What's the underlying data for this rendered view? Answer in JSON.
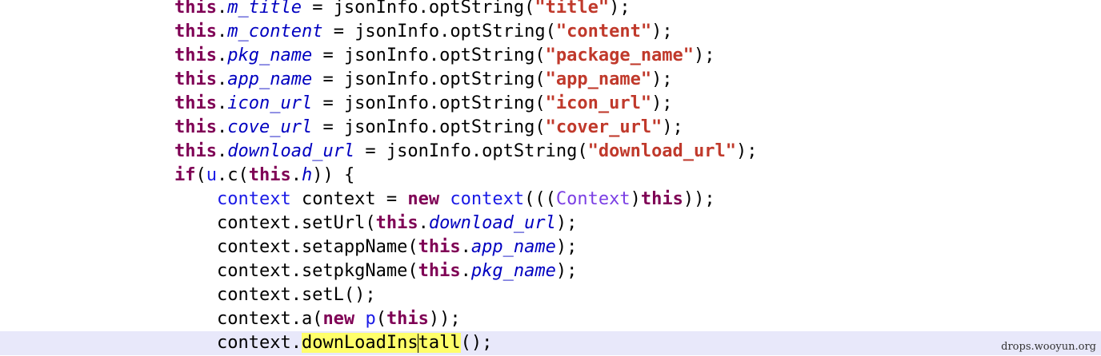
{
  "editor": {
    "lines": [
      [
        {
          "t": "this",
          "c": "kw"
        },
        {
          "t": ".",
          "c": "plain"
        },
        {
          "t": "m_title",
          "c": "field"
        },
        {
          "t": " = jsonInfo.optString(",
          "c": "plain"
        },
        {
          "t": "\"title\"",
          "c": "str"
        },
        {
          "t": ");",
          "c": "plain"
        }
      ],
      [
        {
          "t": "this",
          "c": "kw"
        },
        {
          "t": ".",
          "c": "plain"
        },
        {
          "t": "m_content",
          "c": "field"
        },
        {
          "t": " = jsonInfo.optString(",
          "c": "plain"
        },
        {
          "t": "\"content\"",
          "c": "str"
        },
        {
          "t": ");",
          "c": "plain"
        }
      ],
      [
        {
          "t": "this",
          "c": "kw"
        },
        {
          "t": ".",
          "c": "plain"
        },
        {
          "t": "pkg_name",
          "c": "field"
        },
        {
          "t": " = jsonInfo.optString(",
          "c": "plain"
        },
        {
          "t": "\"package_name\"",
          "c": "str"
        },
        {
          "t": ");",
          "c": "plain"
        }
      ],
      [
        {
          "t": "this",
          "c": "kw"
        },
        {
          "t": ".",
          "c": "plain"
        },
        {
          "t": "app_name",
          "c": "field"
        },
        {
          "t": " = jsonInfo.optString(",
          "c": "plain"
        },
        {
          "t": "\"app_name\"",
          "c": "str"
        },
        {
          "t": ");",
          "c": "plain"
        }
      ],
      [
        {
          "t": "this",
          "c": "kw"
        },
        {
          "t": ".",
          "c": "plain"
        },
        {
          "t": "icon_url",
          "c": "field"
        },
        {
          "t": " = jsonInfo.optString(",
          "c": "plain"
        },
        {
          "t": "\"icon_url\"",
          "c": "str"
        },
        {
          "t": ");",
          "c": "plain"
        }
      ],
      [
        {
          "t": "this",
          "c": "kw"
        },
        {
          "t": ".",
          "c": "plain"
        },
        {
          "t": "cove_url",
          "c": "field"
        },
        {
          "t": " = jsonInfo.optString(",
          "c": "plain"
        },
        {
          "t": "\"cover_url\"",
          "c": "str"
        },
        {
          "t": ");",
          "c": "plain"
        }
      ],
      [
        {
          "t": "this",
          "c": "kw"
        },
        {
          "t": ".",
          "c": "plain"
        },
        {
          "t": "download_url",
          "c": "field"
        },
        {
          "t": " = jsonInfo.optString(",
          "c": "plain"
        },
        {
          "t": "\"download_url\"",
          "c": "str"
        },
        {
          "t": ");",
          "c": "plain"
        }
      ],
      [
        {
          "t": "if",
          "c": "kw"
        },
        {
          "t": "(",
          "c": "plain"
        },
        {
          "t": "u",
          "c": "type"
        },
        {
          "t": ".c(",
          "c": "plain"
        },
        {
          "t": "this",
          "c": "kw"
        },
        {
          "t": ".",
          "c": "plain"
        },
        {
          "t": "h",
          "c": "field"
        },
        {
          "t": ")) {",
          "c": "plain"
        }
      ],
      [
        {
          "t": "    ",
          "c": "plain"
        },
        {
          "t": "context",
          "c": "type"
        },
        {
          "t": " context = ",
          "c": "plain"
        },
        {
          "t": "new",
          "c": "kw"
        },
        {
          "t": " ",
          "c": "plain"
        },
        {
          "t": "context",
          "c": "type"
        },
        {
          "t": "(((",
          "c": "plain"
        },
        {
          "t": "Context",
          "c": "cast"
        },
        {
          "t": ")",
          "c": "plain"
        },
        {
          "t": "this",
          "c": "kw"
        },
        {
          "t": "));",
          "c": "plain"
        }
      ],
      [
        {
          "t": "    context.setUrl(",
          "c": "plain"
        },
        {
          "t": "this",
          "c": "kw"
        },
        {
          "t": ".",
          "c": "plain"
        },
        {
          "t": "download_url",
          "c": "field"
        },
        {
          "t": ");",
          "c": "plain"
        }
      ],
      [
        {
          "t": "    context.setappName(",
          "c": "plain"
        },
        {
          "t": "this",
          "c": "kw"
        },
        {
          "t": ".",
          "c": "plain"
        },
        {
          "t": "app_name",
          "c": "field"
        },
        {
          "t": ");",
          "c": "plain"
        }
      ],
      [
        {
          "t": "    context.setpkgName(",
          "c": "plain"
        },
        {
          "t": "this",
          "c": "kw"
        },
        {
          "t": ".",
          "c": "plain"
        },
        {
          "t": "pkg_name",
          "c": "field"
        },
        {
          "t": ");",
          "c": "plain"
        }
      ],
      [
        {
          "t": "    context.setL();",
          "c": "plain"
        }
      ],
      [
        {
          "t": "    context.a(",
          "c": "plain"
        },
        {
          "t": "new",
          "c": "kw"
        },
        {
          "t": " ",
          "c": "plain"
        },
        {
          "t": "p",
          "c": "type"
        },
        {
          "t": "(",
          "c": "plain"
        },
        {
          "t": "this",
          "c": "kw"
        },
        {
          "t": "));",
          "c": "plain"
        }
      ],
      [
        {
          "t": "    context.",
          "c": "plain"
        },
        {
          "t": "downLoadIns",
          "c": "hl"
        },
        {
          "t": "|caret|",
          "c": "caret"
        },
        {
          "t": "tall",
          "c": "hl"
        },
        {
          "t": "();",
          "c": "plain"
        }
      ]
    ],
    "current_line_index": 14
  },
  "watermark": "drops.wooyun.org",
  "colors": {
    "keyword": "#7f0055",
    "field": "#0000c0",
    "string": "#c0392b",
    "type": "#1a1ae6",
    "highlight": "#ffff6a",
    "current_line": "#e8e8fa"
  }
}
